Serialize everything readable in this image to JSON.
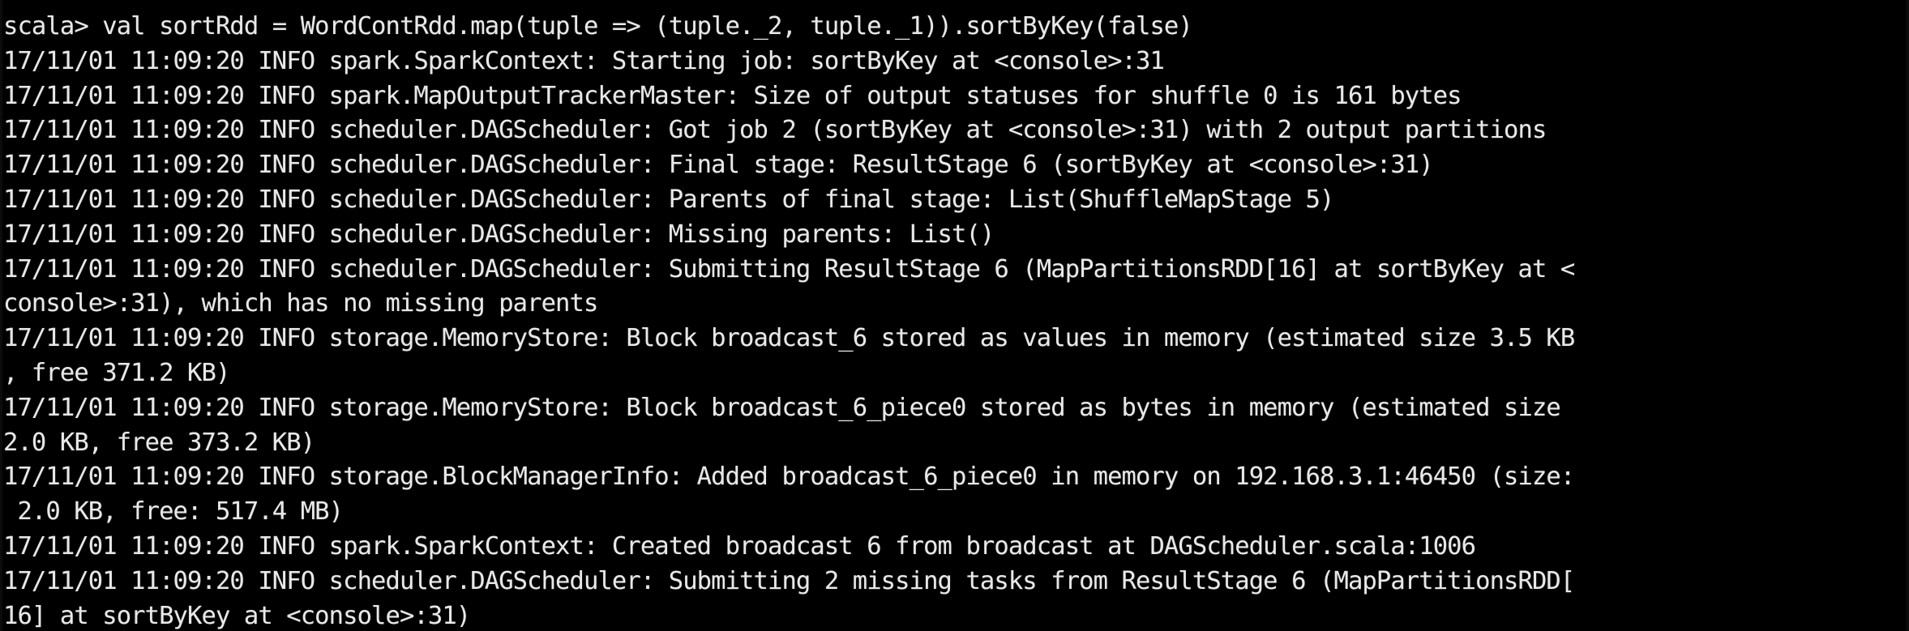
{
  "terminal": {
    "title": "spark-shell scala REPL",
    "colors": {
      "background": "#000000",
      "foreground": "#e8e8e8"
    },
    "prompt": "scala>",
    "shell": "scala",
    "lines": [
      "scala> val sortRdd = WordContRdd.map(tuple => (tuple._2, tuple._1)).sortByKey(false)",
      "17/11/01 11:09:20 INFO spark.SparkContext: Starting job: sortByKey at <console>:31",
      "17/11/01 11:09:20 INFO spark.MapOutputTrackerMaster: Size of output statuses for shuffle 0 is 161 bytes",
      "17/11/01 11:09:20 INFO scheduler.DAGScheduler: Got job 2 (sortByKey at <console>:31) with 2 output partitions",
      "17/11/01 11:09:20 INFO scheduler.DAGScheduler: Final stage: ResultStage 6 (sortByKey at <console>:31)",
      "17/11/01 11:09:20 INFO scheduler.DAGScheduler: Parents of final stage: List(ShuffleMapStage 5)",
      "17/11/01 11:09:20 INFO scheduler.DAGScheduler: Missing parents: List()",
      "17/11/01 11:09:20 INFO scheduler.DAGScheduler: Submitting ResultStage 6 (MapPartitionsRDD[16] at sortByKey at <",
      "console>:31), which has no missing parents",
      "17/11/01 11:09:20 INFO storage.MemoryStore: Block broadcast_6 stored as values in memory (estimated size 3.5 KB",
      ", free 371.2 KB)",
      "17/11/01 11:09:20 INFO storage.MemoryStore: Block broadcast_6_piece0 stored as bytes in memory (estimated size",
      "2.0 KB, free 373.2 KB)",
      "17/11/01 11:09:20 INFO storage.BlockManagerInfo: Added broadcast_6_piece0 in memory on 192.168.3.1:46450 (size:",
      " 2.0 KB, free: 517.4 MB)",
      "17/11/01 11:09:20 INFO spark.SparkContext: Created broadcast 6 from broadcast at DAGScheduler.scala:1006",
      "17/11/01 11:09:20 INFO scheduler.DAGScheduler: Submitting 2 missing tasks from ResultStage 6 (MapPartitionsRDD[",
      "16] at sortByKey at <console>:31)"
    ]
  }
}
